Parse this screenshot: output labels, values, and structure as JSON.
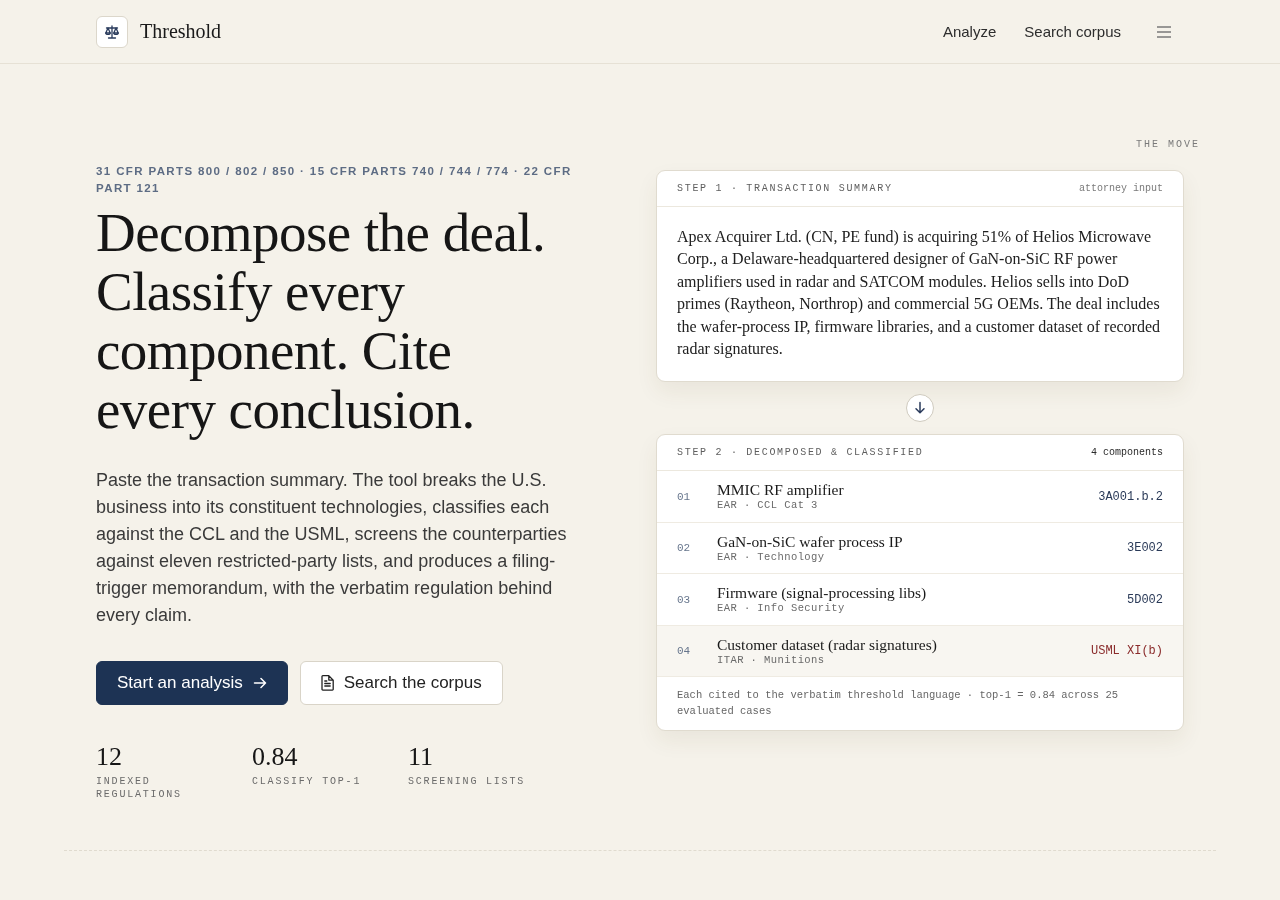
{
  "header": {
    "brand": "Threshold",
    "nav": [
      "Analyze",
      "Search corpus"
    ]
  },
  "hero": {
    "eyebrow": "31 CFR PARTS 800 / 802 / 850 · 15 CFR PARTS 740 / 744 / 774 · 22 CFR PART 121",
    "headline": "Decompose the deal. Classify every component. Cite every conclusion.",
    "description": "Paste the transaction summary. The tool breaks the U.S. business into its constituent technologies, classifies each against the CCL and the USML, screens the counterparties against eleven restricted-party lists, and produces a filing-trigger memorandum, with the verbatim regulation behind every claim.",
    "buttons": [
      {
        "label": "Start an analysis",
        "kind": "primary"
      },
      {
        "label": "Search the corpus",
        "kind": "secondary"
      }
    ],
    "stats": [
      {
        "value": "12",
        "label": "INDEXED REGULATIONS"
      },
      {
        "value": "0.84",
        "label": "CLASSIFY TOP-1"
      },
      {
        "value": "11",
        "label": "SCREENING LISTS"
      }
    ]
  },
  "move": {
    "label": "THE MOVE",
    "step_1": {
      "title": "STEP 1 · TRANSACTION SUMMARY",
      "tag": "attorney input",
      "summary": "Apex Acquirer Ltd. (CN, PE fund) is acquiring 51% of Helios Microwave Corp., a Delaware-headquartered designer of GaN-on-SiC RF power amplifiers used in radar and SATCOM modules. Helios sells into DoD primes (Raytheon, Northrop) and commercial 5G OEMs. The deal includes the wafer-process IP, firmware libraries, and a customer dataset of recorded radar signatures."
    },
    "step_2": {
      "title": "STEP 2 · DECOMPOSED & CLASSIFIED",
      "count": "4 components",
      "components": [
        {
          "number": "01",
          "name": "MMIC RF amplifier",
          "regime": "EAR · CCL Cat 3",
          "classification": "3A001.b.2",
          "kind": "ear"
        },
        {
          "number": "02",
          "name": "GaN-on-SiC wafer process IP",
          "regime": "EAR · Technology",
          "classification": "3E002",
          "kind": "ear"
        },
        {
          "number": "03",
          "name": "Firmware (signal-processing libs)",
          "regime": "EAR · Info Security",
          "classification": "5D002",
          "kind": "ear"
        },
        {
          "number": "04",
          "name": "Customer dataset (radar signatures)",
          "regime": "ITAR · Munitions",
          "classification": "USML XI(b)",
          "kind": "itar"
        }
      ],
      "footnote": "Each cited to the verbatim threshold language · top-1 = 0.84 across 25 evaluated cases"
    }
  }
}
